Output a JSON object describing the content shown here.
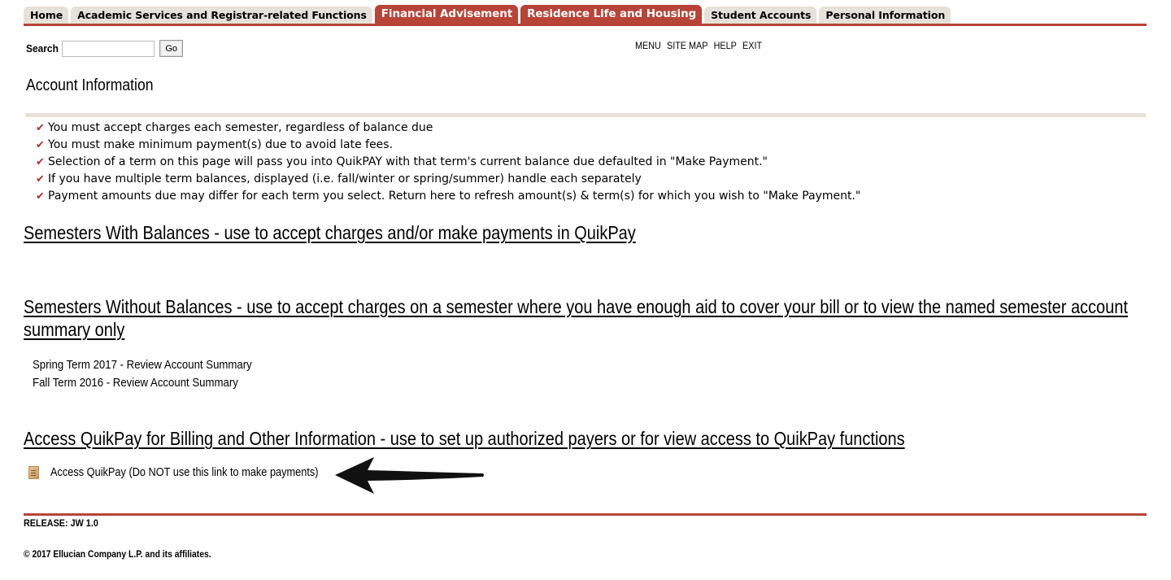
{
  "tabs": [
    {
      "label": "Home",
      "active": false
    },
    {
      "label": "Academic Services and Registrar-related Functions",
      "active": false
    },
    {
      "label": "Financial Advisement",
      "active": true
    },
    {
      "label": "Residence Life and Housing",
      "active": true
    },
    {
      "label": "Student Accounts",
      "active": false
    },
    {
      "label": "Personal Information",
      "active": false
    }
  ],
  "search": {
    "label": "Search",
    "value": "",
    "placeholder": "",
    "button_label": "Go"
  },
  "toplinks": [
    "MENU",
    "SITE MAP",
    "HELP",
    "EXIT"
  ],
  "page_title": "Account Information",
  "info_bullets": [
    "You must accept charges each semester, regardless of balance due",
    "You must make minimum payment(s) due to avoid late fees.",
    "Selection of a term on this page will pass you into QuikPAY with that term's current balance due defaulted in \"Make Payment.\"",
    "If you have multiple term balances, displayed (i.e. fall/winter or spring/summer) handle each separately",
    "Payment amounts due may differ for each term you select. Return here to refresh amount(s) & term(s) for which you wish to \"Make Payment.\""
  ],
  "sections": {
    "with_balances": "Semesters With Balances - use to accept charges and/or make payments in QuikPay",
    "without_balances_line1": "Semesters Without Balances - use to accept charges on a semester where you have enough aid to cover your bill or to view the named semester account",
    "without_balances_line2": "summary only",
    "quikpay": "Access QuikPay for Billing and Other Information - use to set up authorized payers or for view access to QuikPay functions"
  },
  "terms": [
    "Spring Term 2017 - Review Account Summary",
    "Fall Term 2016 - Review Account Summary"
  ],
  "quikpay_link": "Access QuikPay (Do NOT use this link to make payments)",
  "footer": {
    "release": "RELEASE: JW 1.0",
    "copyright": "© 2017 Ellucian Company L.P. and its affiliates."
  },
  "colors": {
    "accent": "#b84337",
    "tab_inactive": "#e7e2d9",
    "check": "#b3312a"
  }
}
